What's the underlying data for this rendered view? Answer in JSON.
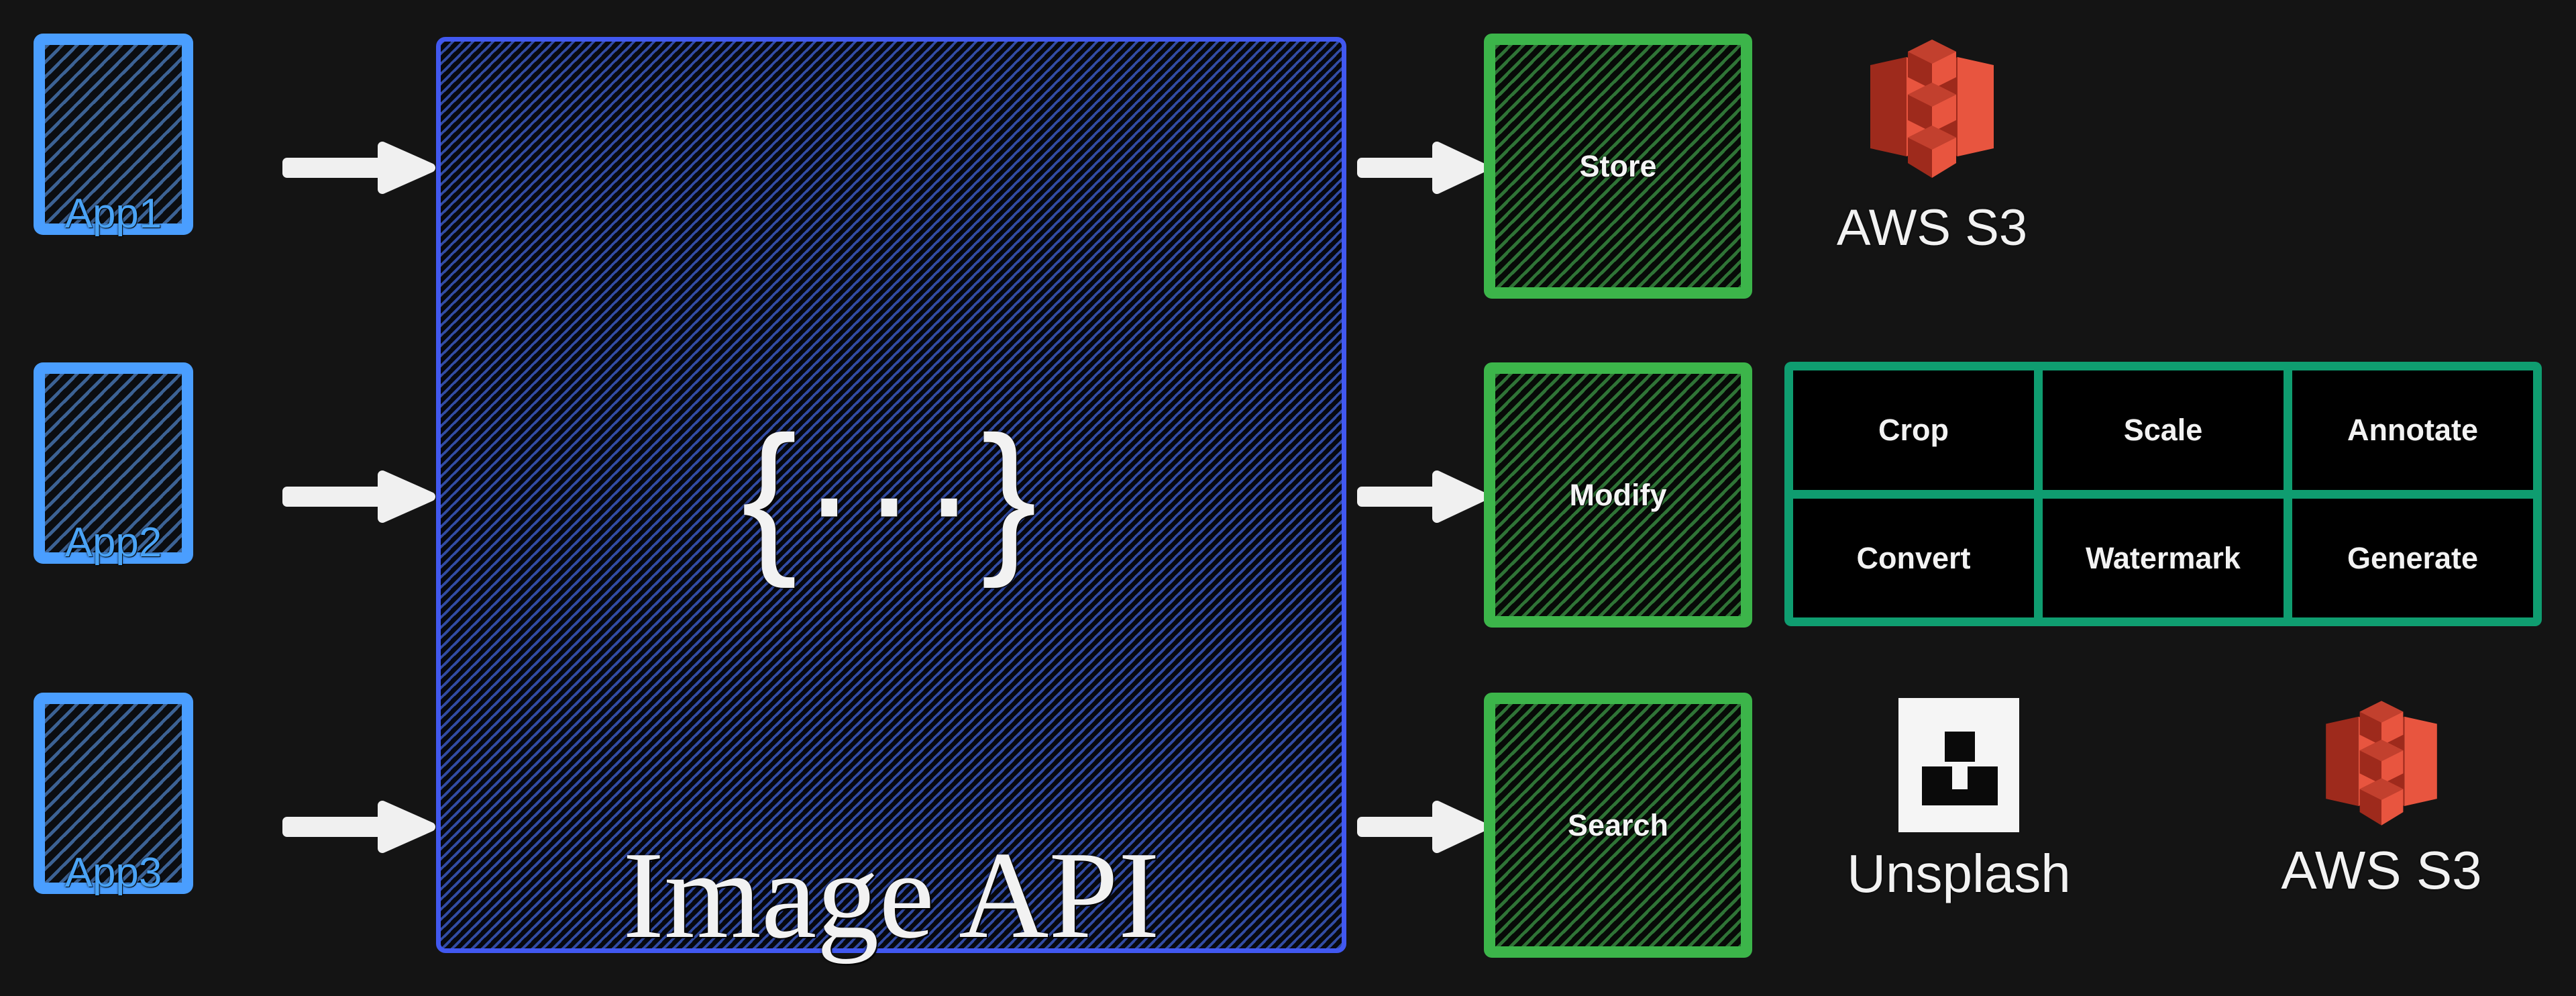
{
  "diagram": {
    "title": "Image API architecture",
    "background_color": "#141414"
  },
  "clients": {
    "accent_color": "#4a9eff",
    "items": [
      {
        "label": "App1"
      },
      {
        "label": "App2"
      },
      {
        "label": "App3"
      }
    ]
  },
  "api": {
    "title": "Image API",
    "glyph": "{···}",
    "accent_color": "#4158f0"
  },
  "actions": {
    "accent_color": "#3cb54a",
    "items": [
      {
        "label": "Store"
      },
      {
        "label": "Modify"
      },
      {
        "label": "Search"
      }
    ]
  },
  "operations": {
    "accent_color": "#0f9d70",
    "rows": [
      [
        "Crop",
        "Scale",
        "Annotate"
      ],
      [
        "Convert",
        "Watermark",
        "Generate"
      ]
    ]
  },
  "providers": {
    "store": {
      "name": "AWS S3",
      "icon": "aws-s3-icon",
      "color": "#e8553f"
    },
    "search_unsplash": {
      "name": "Unsplash",
      "icon": "unsplash-icon",
      "color": "#f5f5f5"
    },
    "search_s3": {
      "name": "AWS S3",
      "icon": "aws-s3-icon",
      "color": "#e8553f"
    }
  },
  "arrows": {
    "color": "#f0f0f0",
    "items": [
      {
        "from": "App1",
        "to": "Image API"
      },
      {
        "from": "App2",
        "to": "Image API"
      },
      {
        "from": "App3",
        "to": "Image API"
      },
      {
        "from": "Image API",
        "to": "Store"
      },
      {
        "from": "Image API",
        "to": "Modify"
      },
      {
        "from": "Image API",
        "to": "Search"
      }
    ]
  }
}
